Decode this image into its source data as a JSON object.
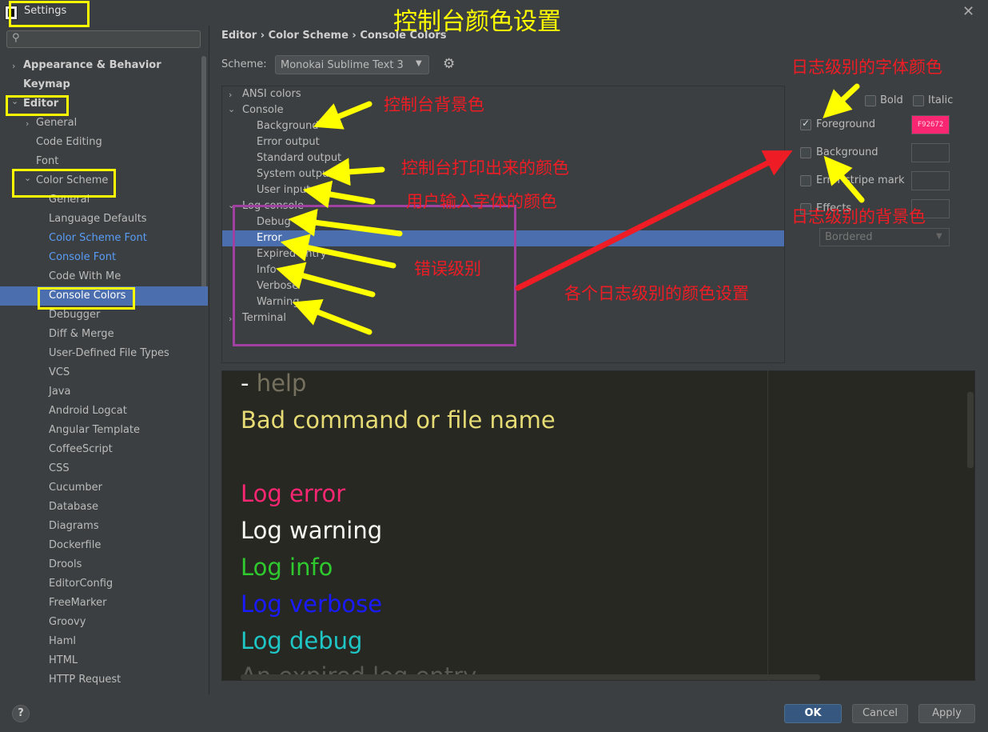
{
  "window": {
    "title": "Settings",
    "close_glyph": "✕"
  },
  "search": {
    "placeholder": ""
  },
  "sidebar": {
    "items": [
      {
        "label": "Appearance & Behavior"
      },
      {
        "label": "Keymap"
      },
      {
        "label": "Editor"
      },
      {
        "label": "General"
      },
      {
        "label": "Code Editing"
      },
      {
        "label": "Font"
      },
      {
        "label": "Color Scheme"
      },
      {
        "label": "General"
      },
      {
        "label": "Language Defaults"
      },
      {
        "label": "Color Scheme Font"
      },
      {
        "label": "Console Font"
      },
      {
        "label": "Code With Me"
      },
      {
        "label": "Console Colors"
      },
      {
        "label": "Debugger"
      },
      {
        "label": "Diff & Merge"
      },
      {
        "label": "User-Defined File Types"
      },
      {
        "label": "VCS"
      },
      {
        "label": "Java"
      },
      {
        "label": "Android Logcat"
      },
      {
        "label": "Angular Template"
      },
      {
        "label": "CoffeeScript"
      },
      {
        "label": "CSS"
      },
      {
        "label": "Cucumber"
      },
      {
        "label": "Database"
      },
      {
        "label": "Diagrams"
      },
      {
        "label": "Dockerfile"
      },
      {
        "label": "Drools"
      },
      {
        "label": "EditorConfig"
      },
      {
        "label": "FreeMarker"
      },
      {
        "label": "Groovy"
      },
      {
        "label": "Haml"
      },
      {
        "label": "HTML"
      },
      {
        "label": "HTTP Request"
      }
    ]
  },
  "breadcrumb": "Editor  ›  Color Scheme  ›  Console Colors",
  "scheme": {
    "label": "Scheme:",
    "value": "Monokai Sublime Text 3"
  },
  "tree": {
    "items": [
      {
        "label": "ANSI colors"
      },
      {
        "label": "Console"
      },
      {
        "label": "Background"
      },
      {
        "label": "Error output"
      },
      {
        "label": "Standard output"
      },
      {
        "label": "System output"
      },
      {
        "label": "User input"
      },
      {
        "label": "Log console"
      },
      {
        "label": "Debug"
      },
      {
        "label": "Error"
      },
      {
        "label": "Expired entry"
      },
      {
        "label": "Info"
      },
      {
        "label": "Verbose"
      },
      {
        "label": "Warning"
      },
      {
        "label": "Terminal"
      }
    ]
  },
  "attributes": {
    "bold": "Bold",
    "italic": "Italic",
    "foreground": "Foreground",
    "foreground_value": "F92672",
    "background": "Background",
    "error_stripe": "Error stripe mark",
    "effects": "Effects",
    "effects_type": "Bordered"
  },
  "preview": {
    "lines": [
      {
        "dash": "- ",
        "text": "help",
        "color": "#75715e"
      },
      {
        "text": "Bad command or file name",
        "color": "#e6db74"
      },
      {
        "text": "Log error",
        "color": "#f92672"
      },
      {
        "text": "Log warning",
        "color": "#f8f8f2"
      },
      {
        "text": "Log info",
        "color": "#2fc92f"
      },
      {
        "text": "Log verbose",
        "color": "#1a1aff"
      },
      {
        "text": "Log debug",
        "color": "#1fc6c6"
      },
      {
        "text": "An expired log entry",
        "color": "#5a5a55"
      }
    ]
  },
  "buttons": {
    "help": "?",
    "ok": "OK",
    "cancel": "Cancel",
    "apply": "Apply"
  },
  "annotations": {
    "title": "控制台颜色设置",
    "fg_font_color": "日志级别的字体颜色",
    "console_bg": "控制台背景色",
    "printed_color": "控制台打印出来的颜色",
    "user_input_color": "用户输入字体的颜色",
    "log_bg": "日志级别的背景色",
    "error_level": "错误级别",
    "each_level": "各个日志级别的颜色设置"
  },
  "colors": {
    "accent": "#4b6eaf",
    "link": "#589df6",
    "foreground_swatch": "#f92672",
    "highlight": "#ffff00",
    "annotation_red": "#ee1c24",
    "annotation_purple": "#a040a0"
  }
}
